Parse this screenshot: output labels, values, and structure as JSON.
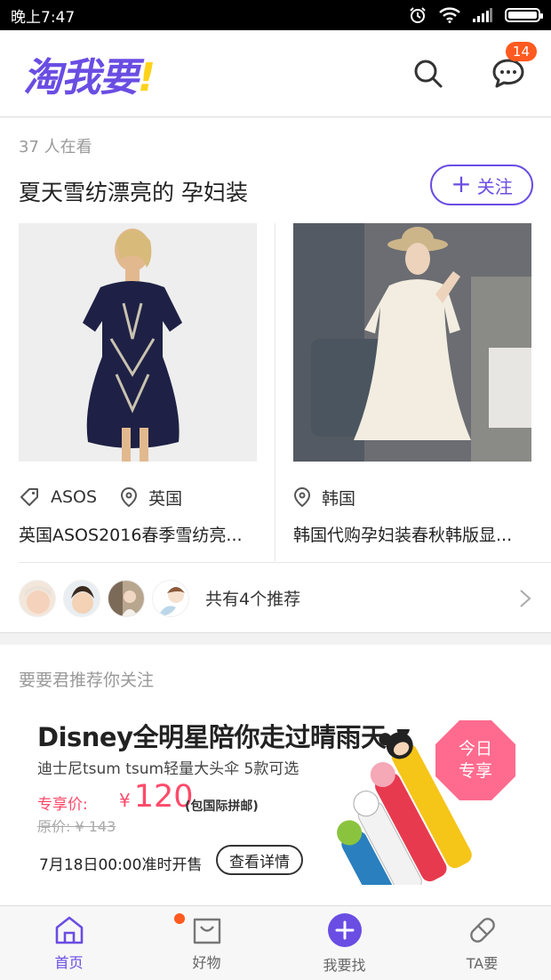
{
  "status_bar": {
    "time": "晚上7:47"
  },
  "header": {
    "logo_text": "淘我要",
    "logo_bang": "!",
    "message_count": "14"
  },
  "feed": {
    "viewers": "37 人在看",
    "topic_title": "夏天雪纺漂亮的 孕妇装",
    "follow_label": "关注",
    "products": [
      {
        "brand": "ASOS",
        "location": "英国",
        "title": "英国ASOS2016春季雪纺亮..."
      },
      {
        "location": "韩国",
        "title": "韩国代购孕妇装春秋韩版显..."
      }
    ],
    "recommend_text": "共有4个推荐"
  },
  "section2": {
    "title": "要要君推荐你关注"
  },
  "banner": {
    "headline": "Disney全明星陪你走过晴雨天",
    "subtitle": "迪士尼tsum tsum轻量大头伞 5款可选",
    "price_label": "专享价:",
    "currency": "¥",
    "price": "120",
    "shipping": "(包国际拼邮)",
    "original_price": "原价: ¥ 143",
    "date_text": "7月18日00:00准时开售",
    "detail_button": "查看详情",
    "badge_line1": "今日",
    "badge_line2": "专享"
  },
  "bottom_nav": {
    "items": [
      {
        "label": "首页"
      },
      {
        "label": "好物"
      },
      {
        "label": "我要找"
      },
      {
        "label": "TA要"
      }
    ]
  },
  "colors": {
    "brand": "#6a4de3",
    "badge": "#ff5a1f",
    "price": "#ff4a6a"
  }
}
